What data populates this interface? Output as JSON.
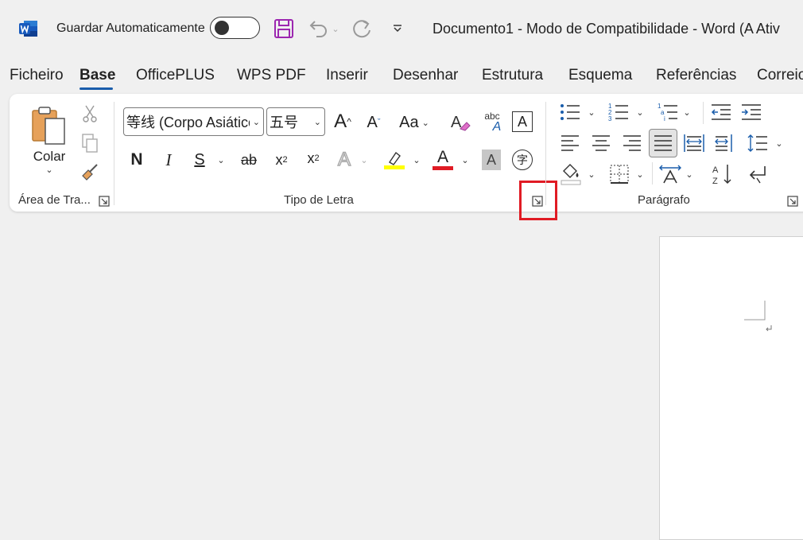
{
  "titlebar": {
    "autosave_label": "Guardar Automaticamente",
    "document_title": "Documento1  -  Modo de Compatibilidade  -  Word (A Ativ"
  },
  "tabs": [
    {
      "label": "Ficheiro"
    },
    {
      "label": "Base"
    },
    {
      "label": "OfficePLUS"
    },
    {
      "label": "WPS PDF"
    },
    {
      "label": "Inserir"
    },
    {
      "label": "Desenhar"
    },
    {
      "label": "Estrutura"
    },
    {
      "label": "Esquema"
    },
    {
      "label": "Referências"
    },
    {
      "label": "Correio"
    }
  ],
  "ribbon": {
    "clipboard": {
      "paste_label": "Colar",
      "group_label": "Área de Tra..."
    },
    "font": {
      "font_name": "等线 (Corpo Asiático)",
      "font_size": "五号",
      "change_case": "Aa",
      "bold": "N",
      "italic": "I",
      "underline": "S",
      "strikethrough": "ab",
      "subscript": "x",
      "subscript_mark": "2",
      "superscript": "x",
      "superscript_mark": "2",
      "text_effects": "A",
      "font_color_letter": "A",
      "char_shading": "A",
      "phonetic_guide": "字",
      "clear_format_abc": "abc",
      "clear_format_a": "A",
      "char_border": "A",
      "grow_letter": "A",
      "shrink_letter": "A",
      "group_label": "Tipo de Letra"
    },
    "paragraph": {
      "group_label": "Parágrafo"
    }
  },
  "colors": {
    "accent": "#1a5dab",
    "highlight_yellow": "#ffff00",
    "font_color_red": "#e01b24",
    "save_purple": "#9c27b0",
    "callout_red": "#e01b24"
  }
}
